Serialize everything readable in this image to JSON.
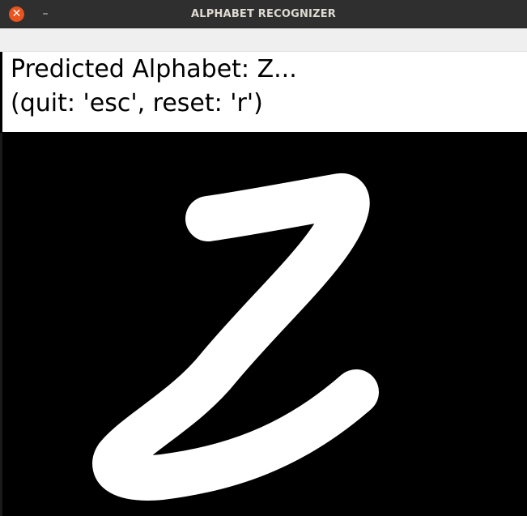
{
  "window": {
    "title": "ALPHABET RECOGNIZER",
    "close_symbol": "✕",
    "minimize_symbol": "–"
  },
  "status": {
    "prediction_line": "Predicted Alphabet: Z...",
    "help_line": "(quit: 'esc', reset: 'r')"
  },
  "canvas": {
    "background_color": "#000000",
    "stroke_color": "#ffffff",
    "drawn_shape": "handwritten-letter-z"
  },
  "colors": {
    "titlebar": "#2f2f2f",
    "close_button": "#e9541f",
    "toolbar_strip": "#efefef",
    "text_panel": "#ffffff"
  }
}
